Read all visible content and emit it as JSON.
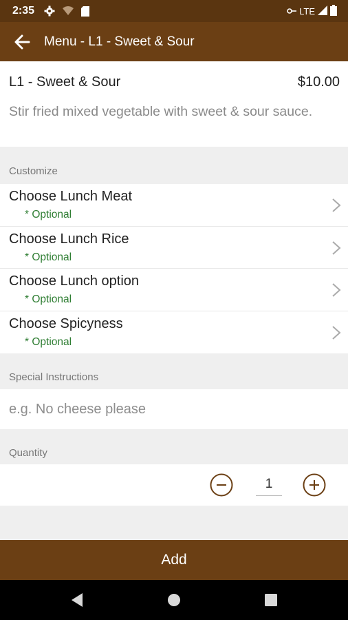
{
  "status": {
    "time": "2:35",
    "network": "LTE"
  },
  "appbar": {
    "title": "Menu - L1 - Sweet & Sour"
  },
  "item": {
    "name": "L1 - Sweet & Sour",
    "price": "$10.00",
    "description": "Stir fried mixed vegetable with sweet & sour sauce."
  },
  "customize": {
    "label": "Customize",
    "options": [
      {
        "name": "Choose Lunch Meat",
        "tag": "* Optional"
      },
      {
        "name": "Choose Lunch Rice",
        "tag": "* Optional"
      },
      {
        "name": "Choose Lunch option",
        "tag": "* Optional"
      },
      {
        "name": "Choose Spicyness",
        "tag": "* Optional"
      }
    ]
  },
  "instructions": {
    "label": "Special Instructions",
    "placeholder": "e.g. No cheese please"
  },
  "quantity": {
    "label": "Quantity",
    "value": "1"
  },
  "add_button": {
    "label": "Add"
  },
  "colors": {
    "brand_brown": "#6b3f14",
    "optional_green": "#2e7d32"
  }
}
